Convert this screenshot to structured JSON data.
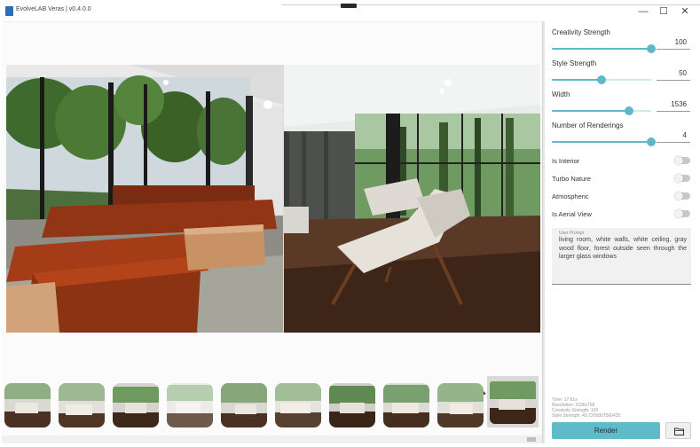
{
  "window": {
    "title": "EvolveLAB Veras | v0.4.0.0",
    "minimize_glyph": "—",
    "maximize_glyph": "☐",
    "close_glyph": "✕"
  },
  "panel": {
    "sliders": [
      {
        "label": "Creativity Strength",
        "value": "100",
        "fraction": 1.0
      },
      {
        "label": "Style Strength",
        "value": "50",
        "fraction": 0.5
      },
      {
        "label": "Width",
        "value": "1536",
        "fraction": 0.78
      },
      {
        "label": "Number of Renderings",
        "value": "4",
        "fraction": 1.0
      }
    ],
    "toggles": [
      {
        "label": "Is Interior",
        "on": false
      },
      {
        "label": "Turbo Nature",
        "on": false
      },
      {
        "label": "Atmospheric",
        "on": false
      },
      {
        "label": "Is Aerial View",
        "on": false
      }
    ],
    "prompt": {
      "label": "User Prompt",
      "text": "living room, white walls, white ceiling, gray wood floor, forest outside seen through the larger glass windows"
    },
    "info": {
      "time": "Time: 17.61s",
      "resolution": "Resolution: 1536x768",
      "creativity": "Creativity Strength: 100",
      "style": "Style Strength: 49.7265807560425"
    },
    "render_label": "Render",
    "folder_icon": "folder-icon"
  },
  "thumbnails": {
    "count": 10,
    "selected_index": 9
  },
  "colors": {
    "accent": "#5fb8c8",
    "render_button": "#5fbac9"
  }
}
